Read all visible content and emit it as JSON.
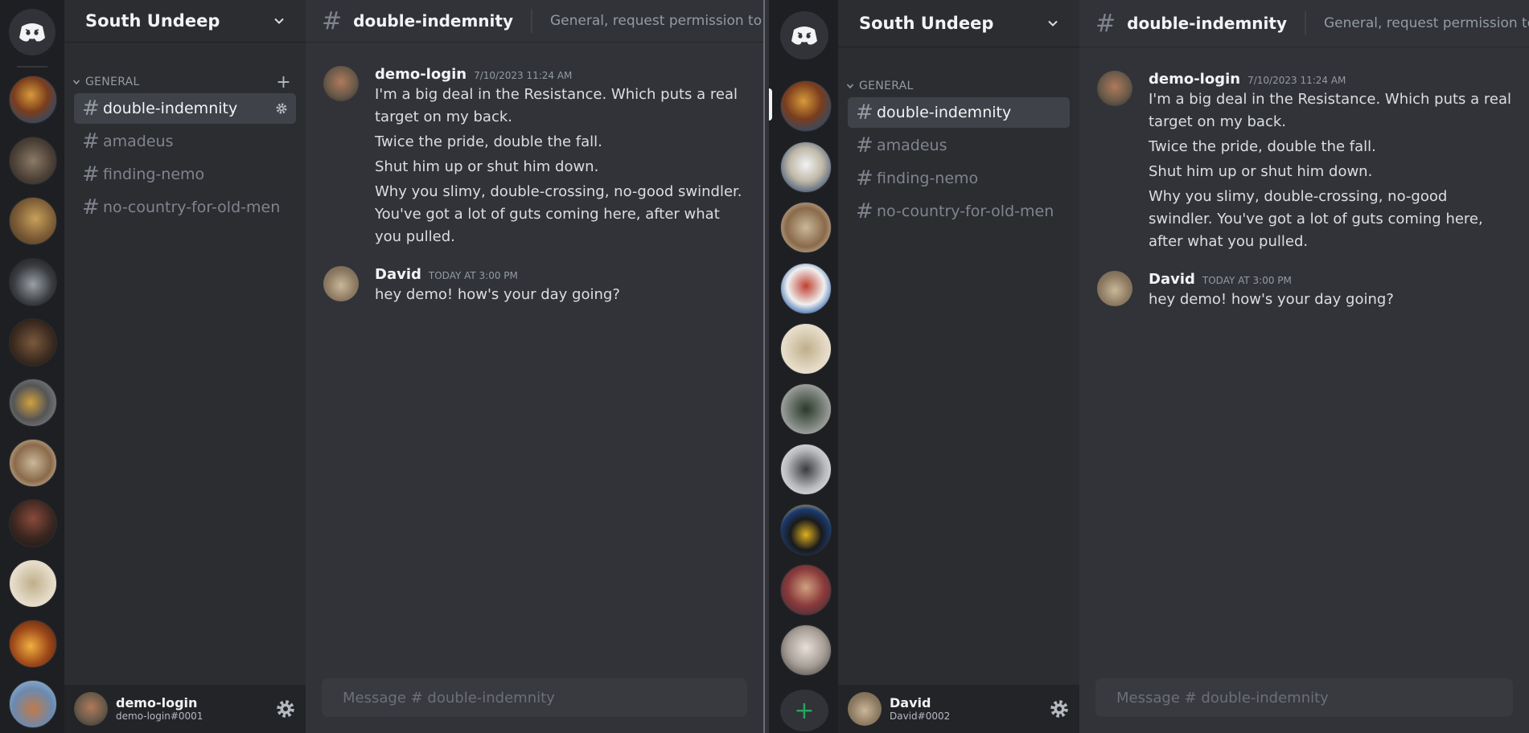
{
  "colors": {
    "rail_bg": "#1e1f22",
    "sidebar_bg": "#2b2d31",
    "chat_bg": "#313338",
    "userbar_bg": "#232428",
    "active_channel_bg": "#404249",
    "composer_bg": "#383a40"
  },
  "panes": [
    {
      "server_name": "South Undeep",
      "category": "GENERAL",
      "channels": [
        {
          "name": "double-indemnity",
          "active": true
        },
        {
          "name": "amadeus",
          "active": false
        },
        {
          "name": "finding-nemo",
          "active": false
        },
        {
          "name": "no-country-for-old-men",
          "active": false
        }
      ],
      "chat": {
        "channel": "double-indemnity",
        "topic": "General, request permission to bea",
        "composer_placeholder": "Message # double-indemnity"
      },
      "messages": [
        {
          "author": "demo-login",
          "timestamp": "7/10/2023 11:24 AM",
          "lines": [
            "I'm a big deal in the Resistance. Which puts a real target on my back.",
            "Twice the pride, double the fall.",
            "Shut him up or shut him down.",
            "Why you slimy, double-crossing, no-good swindler. You've got a lot of guts coming here, after what you pulled."
          ]
        },
        {
          "author": "David",
          "timestamp": "TODAY AT 3:00 PM",
          "lines": [
            "hey demo! how's your day going?"
          ]
        }
      ],
      "user": {
        "name": "demo-login",
        "tag": "demo-login#0001"
      }
    },
    {
      "server_name": "South Undeep",
      "category": "GENERAL",
      "channels": [
        {
          "name": "double-indemnity",
          "active": true
        },
        {
          "name": "amadeus",
          "active": false
        },
        {
          "name": "finding-nemo",
          "active": false
        },
        {
          "name": "no-country-for-old-men",
          "active": false
        }
      ],
      "chat": {
        "channel": "double-indemnity",
        "topic": "General, request permission to bea",
        "composer_placeholder": "Message # double-indemnity"
      },
      "messages": [
        {
          "author": "demo-login",
          "timestamp": "7/10/2023 11:24 AM",
          "lines": [
            "I'm a big deal in the Resistance. Which puts a real target on my back.",
            "Twice the pride, double the fall.",
            "Shut him up or shut him down.",
            "Why you slimy, double-crossing, no-good swindler. You've got a lot of guts coming here, after what you pulled."
          ]
        },
        {
          "author": "David",
          "timestamp": "TODAY AT 3:00 PM",
          "lines": [
            "hey demo! how's your day going?"
          ]
        }
      ],
      "user": {
        "name": "David",
        "tag": "David#0002"
      }
    }
  ],
  "icons": {
    "home": "discord-logo-icon",
    "category_chevron": "chevron-down-icon",
    "add_channel": "plus-icon",
    "channel": "hashtag-icon",
    "settings": "gear-icon",
    "add_server": "plus-icon"
  }
}
